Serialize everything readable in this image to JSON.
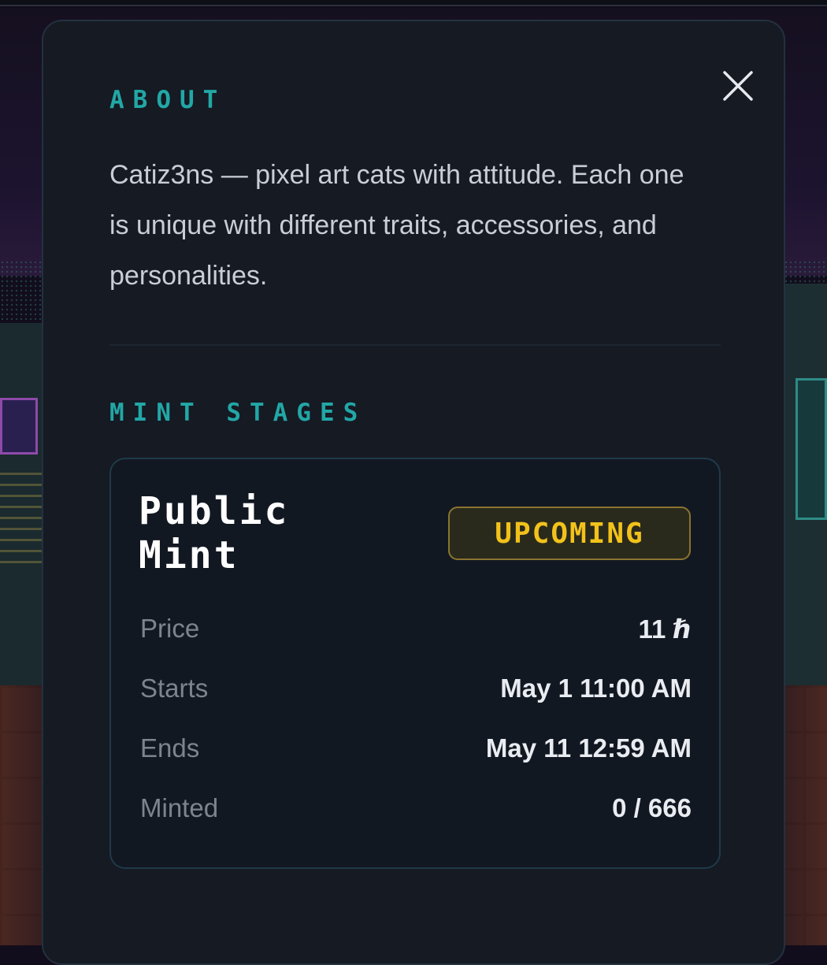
{
  "about": {
    "heading": "ABOUT",
    "text": "Catiz3ns — pixel art cats with attitude. Each one is unique with different traits, accessories, and personalities."
  },
  "mint_stages": {
    "heading": "MINT STAGES",
    "stages": [
      {
        "title": "Public Mint",
        "status": "UPCOMING",
        "rows": [
          {
            "label": "Price",
            "value": "11 ℏ"
          },
          {
            "label": "Starts",
            "value": "May 1 11:00 AM"
          },
          {
            "label": "Ends",
            "value": "May 11 12:59 AM"
          },
          {
            "label": "Minted",
            "value": "0 / 666"
          }
        ]
      }
    ]
  },
  "close_icon": "close-icon",
  "colors": {
    "accent_teal": "#22a7a6",
    "status_yellow": "#f2c21b",
    "modal_bg": "#151a23"
  }
}
